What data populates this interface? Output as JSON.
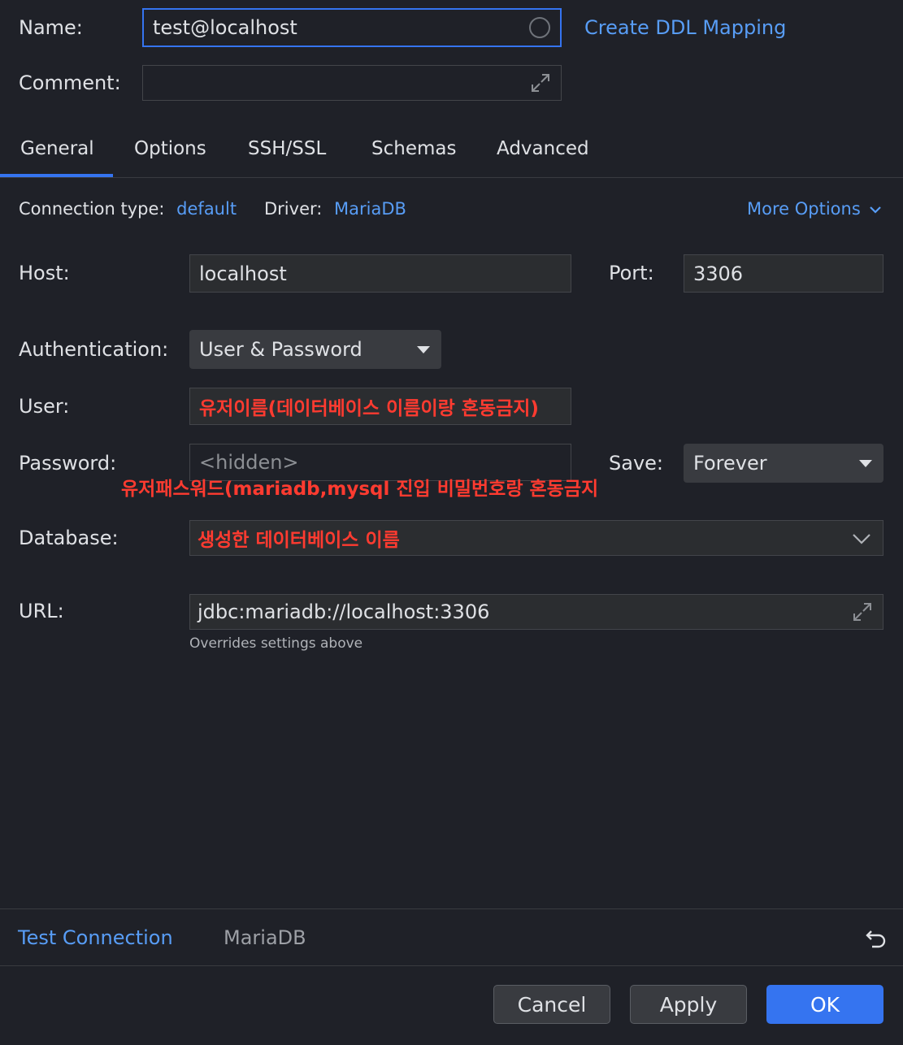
{
  "header": {
    "name_label": "Name:",
    "name_value": "test@localhost",
    "create_ddl_link": "Create DDL Mapping",
    "comment_label": "Comment:",
    "comment_value": ""
  },
  "tabs": [
    {
      "label": "General",
      "active": true
    },
    {
      "label": "Options",
      "active": false
    },
    {
      "label": "SSH/SSL",
      "active": false
    },
    {
      "label": "Schemas",
      "active": false
    },
    {
      "label": "Advanced",
      "active": false
    }
  ],
  "meta": {
    "connection_type_label": "Connection type:",
    "connection_type_value": "default",
    "driver_label": "Driver:",
    "driver_value": "MariaDB",
    "more_options": "More Options"
  },
  "form": {
    "host_label": "Host:",
    "host_value": "localhost",
    "port_label": "Port:",
    "port_value": "3306",
    "auth_label": "Authentication:",
    "auth_value": "User & Password",
    "user_label": "User:",
    "user_value": "유저이름(데이터베이스 이름이랑 혼동금지)",
    "password_label": "Password:",
    "password_placeholder": "<hidden>",
    "password_annotation": "유저패스워드(mariadb,mysql 진입 비밀번호랑 혼동금지",
    "save_label": "Save:",
    "save_value": "Forever",
    "database_label": "Database:",
    "database_value": "생성한 데이터베이스 이름",
    "url_label": "URL:",
    "url_value": "jdbc:mariadb://localhost:3306",
    "url_hint": "Overrides settings above"
  },
  "footer": {
    "test_connection": "Test Connection",
    "driver_name": "MariaDB",
    "cancel": "Cancel",
    "apply": "Apply",
    "ok": "OK"
  },
  "colors": {
    "background": "#1f2128",
    "accent": "#3574f0",
    "link": "#589df6",
    "annotation": "#ff3b30"
  }
}
